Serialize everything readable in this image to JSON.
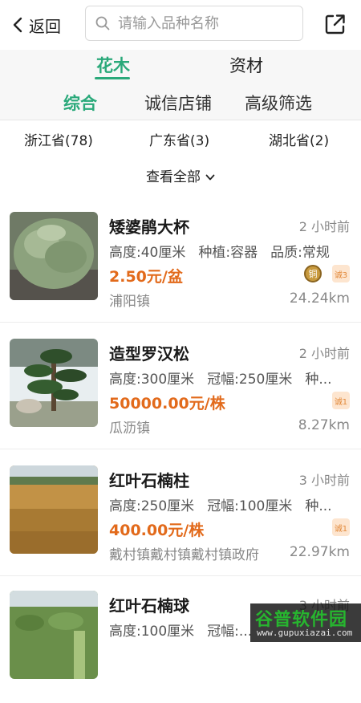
{
  "header": {
    "back_label": "返回",
    "search_placeholder": "请输入品种名称"
  },
  "category_tabs": [
    {
      "label": "花木",
      "active": true
    },
    {
      "label": "资材",
      "active": false
    }
  ],
  "sort_tabs": [
    {
      "label": "综合",
      "active": true
    },
    {
      "label": "诚信店铺",
      "active": false
    },
    {
      "label": "高级筛选",
      "active": false
    }
  ],
  "provinces": [
    {
      "label": "浙江省(78)"
    },
    {
      "label": "广东省(3)"
    },
    {
      "label": "湖北省(2)"
    }
  ],
  "view_all_label": "查看全部",
  "listings": [
    {
      "title": "矮婆鹃大杯",
      "time": "2 小时前",
      "specs": [
        "高度:40厘米",
        "种植:容器",
        "品质:常规"
      ],
      "price": "2.50元/盆",
      "location": "浦阳镇",
      "distance": "24.24km",
      "badges": [
        "铜",
        "诚3"
      ]
    },
    {
      "title": "造型罗汉松",
      "time": "2 小时前",
      "specs": [
        "高度:300厘米",
        "冠幅:250厘米",
        "种..."
      ],
      "price": "50000.00元/株",
      "location": "瓜沥镇",
      "distance": "8.27km",
      "badges": [
        "诚1"
      ]
    },
    {
      "title": "红叶石楠柱",
      "time": "3 小时前",
      "specs": [
        "高度:250厘米",
        "冠幅:100厘米",
        "种..."
      ],
      "price": "400.00元/株",
      "location": "戴村镇戴村镇戴村镇政府",
      "distance": "22.97km",
      "badges": [
        "诚1"
      ]
    },
    {
      "title": "红叶石楠球",
      "time": "3 小时前",
      "specs": [
        "高度:100厘米",
        "冠幅:..."
      ],
      "price": "",
      "location": "",
      "distance": "",
      "badges": []
    }
  ],
  "watermark": {
    "line1": "谷普软件园",
    "line2": "www.gupuxiazai.com"
  },
  "colors": {
    "accent": "#2aa97a",
    "price": "#e26a1b",
    "badge_bg": "#fde5cf"
  }
}
